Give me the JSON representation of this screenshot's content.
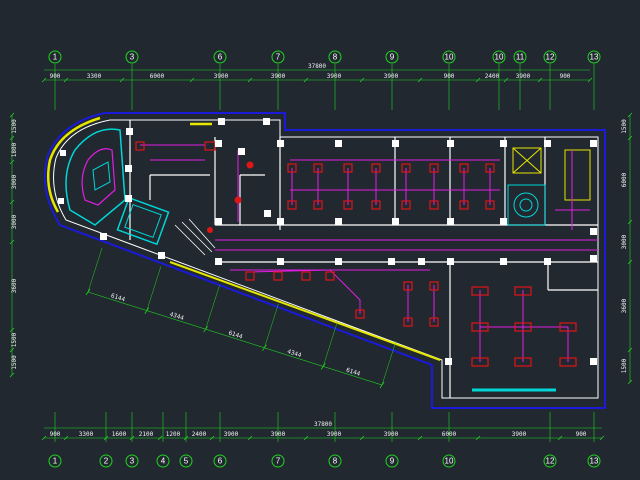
{
  "colors": {
    "background": "#212830",
    "grid": "#1fd51f",
    "wall": "#ffffff",
    "outline": "#1a1ad8",
    "wiring": "#e21ee2",
    "fixture": "#e01515",
    "accent_yellow": "#e6e600",
    "accent_cyan": "#00d6d6",
    "dim_text": "#f2f2f2"
  },
  "top_axes": [
    "1",
    "3",
    "6",
    "7",
    "8",
    "9",
    "10",
    "10",
    "11",
    "12",
    "13"
  ],
  "bottom_axes": [
    "1",
    "2",
    "3",
    "4",
    "5",
    "6",
    "7",
    "8",
    "9",
    "10",
    "12",
    "13"
  ],
  "top_total": "37800",
  "top_dims": [
    "900",
    "3300",
    "6000",
    "3900",
    "3900",
    "3900",
    "3900",
    "900",
    "2400",
    "3900",
    "900"
  ],
  "bottom_total": "37800",
  "bottom_dims": [
    "900",
    "3300",
    "1600",
    "2100",
    "1200",
    "2400",
    "3900",
    "3900",
    "3900",
    "3900",
    "6000",
    "3900",
    "900"
  ],
  "left_dims": [
    "1500",
    "1800",
    "3000",
    "3000",
    "3600",
    "1500",
    "1500"
  ],
  "right_dims": [
    "1500",
    "6000",
    "3000",
    "3600",
    "1500"
  ],
  "diagonal_dims": [
    "6144",
    "4344",
    "6144",
    "4344",
    "6144"
  ]
}
